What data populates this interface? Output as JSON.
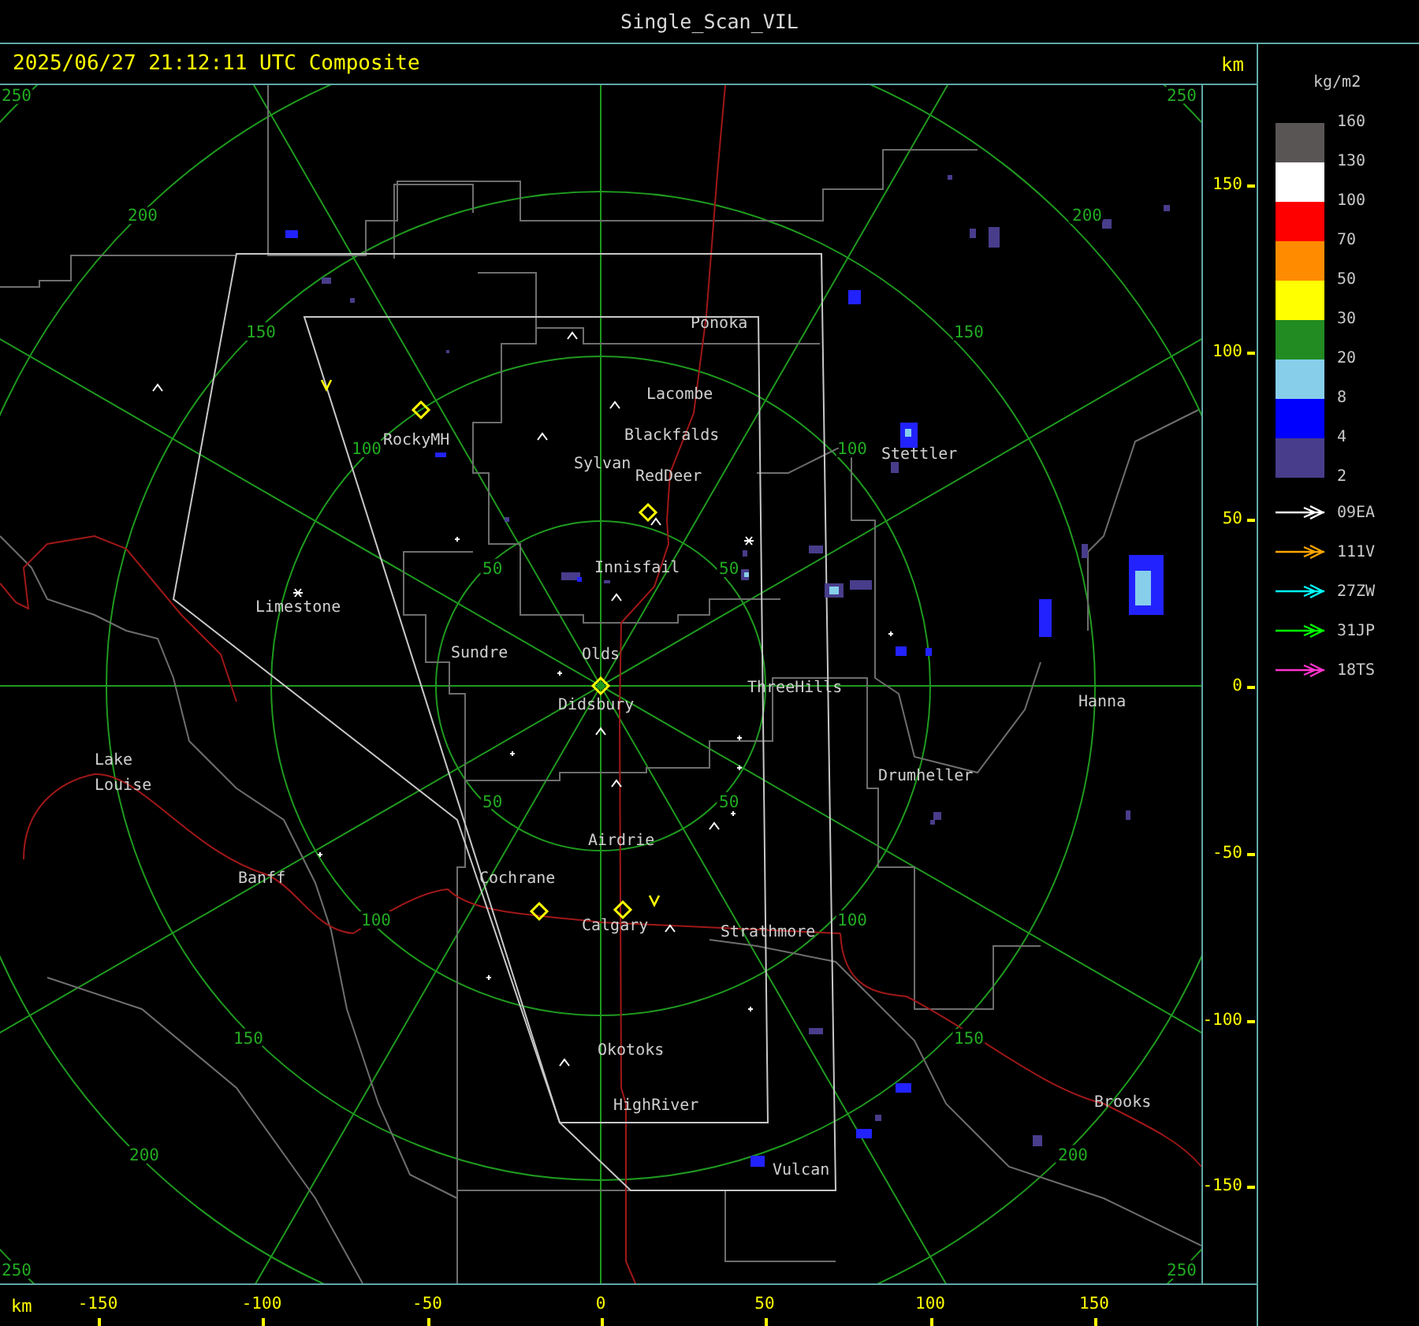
{
  "window": {
    "title": "Single_Scan_VIL"
  },
  "header": {
    "timestamp": "2025/06/27 21:12:11 UTC Composite",
    "unit": "km"
  },
  "map": {
    "ring_labels": [
      "250",
      "250",
      "200",
      "200",
      "150",
      "150",
      "100",
      "100",
      "50",
      "50",
      "50",
      "50",
      "100",
      "100",
      "150",
      "150",
      "200",
      "200",
      "250",
      "250"
    ],
    "places": [
      "Ponoka",
      "Lacombe",
      "Blackfalds",
      "Sylvan",
      "RedDeer",
      "RockyMH",
      "Stettler",
      "Innisfail",
      "Limestone",
      "Sundre",
      "Olds",
      "ThreeHills",
      "Didsbury",
      "Hanna",
      "Lake",
      "Louise",
      "Drumheller",
      "Airdrie",
      "Banff",
      "Cochrane",
      "Calgary",
      "Strathmore",
      "Okotoks",
      "Brooks",
      "HighRiver",
      "Vulcan"
    ],
    "y_ticks": [
      "150",
      "100",
      "50",
      "0",
      "-50",
      "-100",
      "-150"
    ],
    "x_axis": {
      "unit": "km",
      "ticks": [
        "-150",
        "-100",
        "-50",
        "0",
        "50",
        "100",
        "150"
      ]
    }
  },
  "legend": {
    "unit": "kg/m2",
    "bins": [
      {
        "color": "#5a5555"
      },
      {
        "color": "#ffffff"
      },
      {
        "color": "#ff0000"
      },
      {
        "color": "#ff8c00"
      },
      {
        "color": "#ffff00"
      },
      {
        "color": "#228b22"
      },
      {
        "color": "#87ceeb"
      },
      {
        "color": "#0000ff"
      },
      {
        "color": "#483d8b"
      }
    ],
    "labels": [
      "160",
      "130",
      "100",
      "70",
      "50",
      "30",
      "20",
      "8",
      "4",
      "2"
    ]
  },
  "sites": [
    {
      "name": "09EA",
      "color": "#ffffff"
    },
    {
      "name": "111V",
      "color": "#ffa500"
    },
    {
      "name": "27ZW",
      "color": "#00ffff"
    },
    {
      "name": "31JP",
      "color": "#00ff00"
    },
    {
      "name": "18TS",
      "color": "#ff33cc"
    }
  ]
}
